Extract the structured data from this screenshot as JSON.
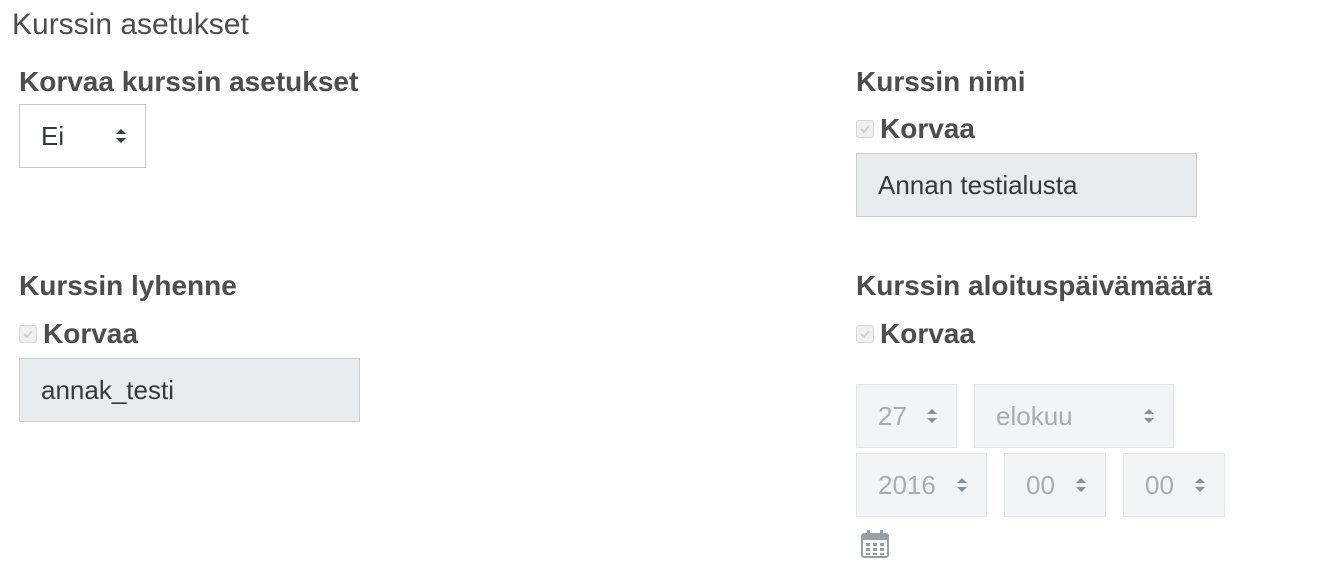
{
  "section": {
    "title": "Kurssin asetukset"
  },
  "override_course_settings": {
    "label": "Korvaa kurssin asetukset",
    "value": "Ei"
  },
  "course_name": {
    "label": "Kurssin nimi",
    "override_label": "Korvaa",
    "value": "Annan testialusta"
  },
  "course_shortname": {
    "label": "Kurssin lyhenne",
    "override_label": "Korvaa",
    "value": "annak_testi"
  },
  "course_startdate": {
    "label": "Kurssin aloituspäivämäärä",
    "override_label": "Korvaa",
    "day": "27",
    "month": "elokuu",
    "year": "2016",
    "hour": "00",
    "minute": "00",
    "calendar_icon": "calendar-icon"
  },
  "colors": {
    "disabled_bg": "#f3f4f5",
    "readonly_input_bg": "#e9ecef",
    "text": "#4d4d4d"
  }
}
